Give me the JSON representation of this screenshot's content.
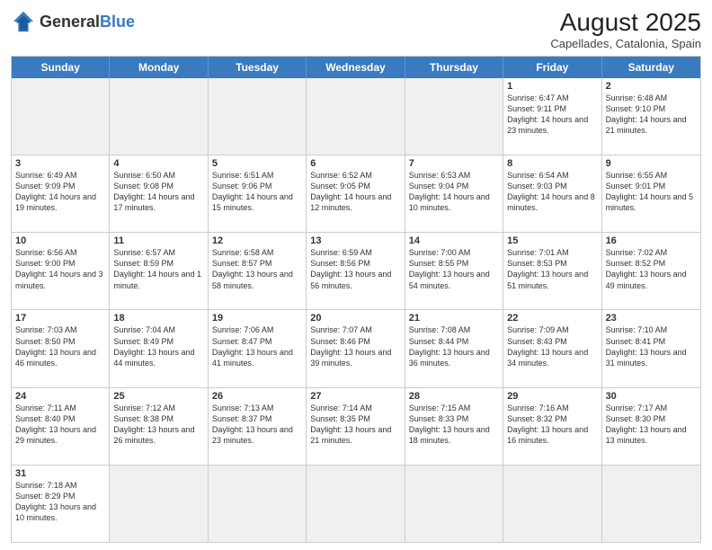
{
  "header": {
    "logo_general": "General",
    "logo_blue": "Blue",
    "month_year": "August 2025",
    "location": "Capellades, Catalonia, Spain"
  },
  "days_of_week": [
    "Sunday",
    "Monday",
    "Tuesday",
    "Wednesday",
    "Thursday",
    "Friday",
    "Saturday"
  ],
  "weeks": [
    [
      {
        "day": "",
        "info": "",
        "empty": true
      },
      {
        "day": "",
        "info": "",
        "empty": true
      },
      {
        "day": "",
        "info": "",
        "empty": true
      },
      {
        "day": "",
        "info": "",
        "empty": true
      },
      {
        "day": "",
        "info": "",
        "empty": true
      },
      {
        "day": "1",
        "info": "Sunrise: 6:47 AM\nSunset: 9:11 PM\nDaylight: 14 hours and 23 minutes."
      },
      {
        "day": "2",
        "info": "Sunrise: 6:48 AM\nSunset: 9:10 PM\nDaylight: 14 hours and 21 minutes."
      }
    ],
    [
      {
        "day": "3",
        "info": "Sunrise: 6:49 AM\nSunset: 9:09 PM\nDaylight: 14 hours and 19 minutes."
      },
      {
        "day": "4",
        "info": "Sunrise: 6:50 AM\nSunset: 9:08 PM\nDaylight: 14 hours and 17 minutes."
      },
      {
        "day": "5",
        "info": "Sunrise: 6:51 AM\nSunset: 9:06 PM\nDaylight: 14 hours and 15 minutes."
      },
      {
        "day": "6",
        "info": "Sunrise: 6:52 AM\nSunset: 9:05 PM\nDaylight: 14 hours and 12 minutes."
      },
      {
        "day": "7",
        "info": "Sunrise: 6:53 AM\nSunset: 9:04 PM\nDaylight: 14 hours and 10 minutes."
      },
      {
        "day": "8",
        "info": "Sunrise: 6:54 AM\nSunset: 9:03 PM\nDaylight: 14 hours and 8 minutes."
      },
      {
        "day": "9",
        "info": "Sunrise: 6:55 AM\nSunset: 9:01 PM\nDaylight: 14 hours and 5 minutes."
      }
    ],
    [
      {
        "day": "10",
        "info": "Sunrise: 6:56 AM\nSunset: 9:00 PM\nDaylight: 14 hours and 3 minutes."
      },
      {
        "day": "11",
        "info": "Sunrise: 6:57 AM\nSunset: 8:59 PM\nDaylight: 14 hours and 1 minute."
      },
      {
        "day": "12",
        "info": "Sunrise: 6:58 AM\nSunset: 8:57 PM\nDaylight: 13 hours and 58 minutes."
      },
      {
        "day": "13",
        "info": "Sunrise: 6:59 AM\nSunset: 8:56 PM\nDaylight: 13 hours and 56 minutes."
      },
      {
        "day": "14",
        "info": "Sunrise: 7:00 AM\nSunset: 8:55 PM\nDaylight: 13 hours and 54 minutes."
      },
      {
        "day": "15",
        "info": "Sunrise: 7:01 AM\nSunset: 8:53 PM\nDaylight: 13 hours and 51 minutes."
      },
      {
        "day": "16",
        "info": "Sunrise: 7:02 AM\nSunset: 8:52 PM\nDaylight: 13 hours and 49 minutes."
      }
    ],
    [
      {
        "day": "17",
        "info": "Sunrise: 7:03 AM\nSunset: 8:50 PM\nDaylight: 13 hours and 46 minutes."
      },
      {
        "day": "18",
        "info": "Sunrise: 7:04 AM\nSunset: 8:49 PM\nDaylight: 13 hours and 44 minutes."
      },
      {
        "day": "19",
        "info": "Sunrise: 7:06 AM\nSunset: 8:47 PM\nDaylight: 13 hours and 41 minutes."
      },
      {
        "day": "20",
        "info": "Sunrise: 7:07 AM\nSunset: 8:46 PM\nDaylight: 13 hours and 39 minutes."
      },
      {
        "day": "21",
        "info": "Sunrise: 7:08 AM\nSunset: 8:44 PM\nDaylight: 13 hours and 36 minutes."
      },
      {
        "day": "22",
        "info": "Sunrise: 7:09 AM\nSunset: 8:43 PM\nDaylight: 13 hours and 34 minutes."
      },
      {
        "day": "23",
        "info": "Sunrise: 7:10 AM\nSunset: 8:41 PM\nDaylight: 13 hours and 31 minutes."
      }
    ],
    [
      {
        "day": "24",
        "info": "Sunrise: 7:11 AM\nSunset: 8:40 PM\nDaylight: 13 hours and 29 minutes."
      },
      {
        "day": "25",
        "info": "Sunrise: 7:12 AM\nSunset: 8:38 PM\nDaylight: 13 hours and 26 minutes."
      },
      {
        "day": "26",
        "info": "Sunrise: 7:13 AM\nSunset: 8:37 PM\nDaylight: 13 hours and 23 minutes."
      },
      {
        "day": "27",
        "info": "Sunrise: 7:14 AM\nSunset: 8:35 PM\nDaylight: 13 hours and 21 minutes."
      },
      {
        "day": "28",
        "info": "Sunrise: 7:15 AM\nSunset: 8:33 PM\nDaylight: 13 hours and 18 minutes."
      },
      {
        "day": "29",
        "info": "Sunrise: 7:16 AM\nSunset: 8:32 PM\nDaylight: 13 hours and 16 minutes."
      },
      {
        "day": "30",
        "info": "Sunrise: 7:17 AM\nSunset: 8:30 PM\nDaylight: 13 hours and 13 minutes."
      }
    ],
    [
      {
        "day": "31",
        "info": "Sunrise: 7:18 AM\nSunset: 8:29 PM\nDaylight: 13 hours and 10 minutes."
      },
      {
        "day": "",
        "info": "",
        "empty": true
      },
      {
        "day": "",
        "info": "",
        "empty": true
      },
      {
        "day": "",
        "info": "",
        "empty": true
      },
      {
        "day": "",
        "info": "",
        "empty": true
      },
      {
        "day": "",
        "info": "",
        "empty": true
      },
      {
        "day": "",
        "info": "",
        "empty": true
      }
    ]
  ]
}
